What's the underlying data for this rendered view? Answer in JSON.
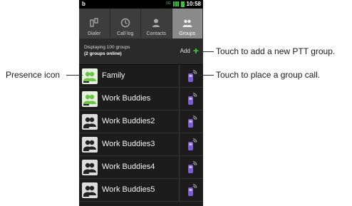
{
  "status": {
    "left": "b",
    "net": "3G",
    "time": "10:58"
  },
  "tabs": [
    {
      "label": "Dialer",
      "icon": "dialer-icon",
      "active": false
    },
    {
      "label": "Call log",
      "icon": "clock-icon",
      "active": false
    },
    {
      "label": "Contacts",
      "icon": "person-icon",
      "active": false
    },
    {
      "label": "Groups",
      "icon": "group-icon",
      "active": true
    }
  ],
  "info": {
    "line1": "Displaying 100 groups",
    "line2": "(2 groups online)",
    "add": "Add"
  },
  "groups": [
    {
      "name": "Family",
      "online": true
    },
    {
      "name": "Work Buddies",
      "online": true
    },
    {
      "name": "Work Buddies2",
      "online": false
    },
    {
      "name": "Work Buddies3",
      "online": false
    },
    {
      "name": "Work Buddies4",
      "online": false
    },
    {
      "name": "Work Buddies5",
      "online": false
    }
  ],
  "callouts": {
    "add": "Touch to add a new PTT group.",
    "call": "Touch to place a group call.",
    "presence": "Presence icon"
  },
  "colors": {
    "accent_green": "#3cd43c",
    "ptt_purple": "#7b5bd6",
    "online_green": "#6cc24a"
  }
}
